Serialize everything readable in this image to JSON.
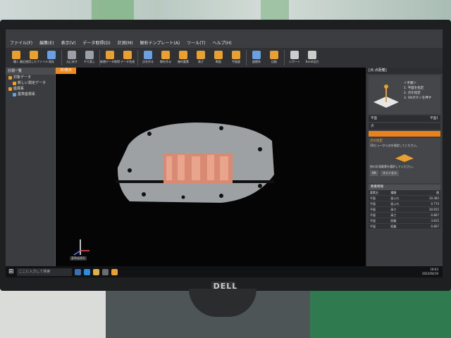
{
  "app": {
    "title": "",
    "menu": [
      "ファイル(F)",
      "編集(E)",
      "表示(V)",
      "データ取得(D)",
      "計測(M)",
      "解析テンプレート(A)",
      "ツール(T)",
      "ヘルプ(H)"
    ]
  },
  "toolbar": {
    "items": [
      {
        "label": "開く",
        "icon": "open-icon",
        "color": "#e8a030"
      },
      {
        "label": "最近使用したファイル",
        "icon": "recent-files-icon",
        "color": "#e8a030"
      },
      {
        "label": "保存",
        "icon": "save-icon",
        "color": "#6aa0e0"
      },
      {
        "label": "元に戻す",
        "icon": "undo-icon",
        "color": "#9aa0a6"
      },
      {
        "label": "やり直し",
        "icon": "redo-icon",
        "color": "#9aa0a6"
      },
      {
        "label": "新規データ取得",
        "icon": "new-data-icon",
        "color": "#e8a030"
      },
      {
        "label": "データ合成",
        "icon": "data-merge-icon",
        "color": "#e8a030"
      },
      {
        "label": "点を作る",
        "icon": "point-icon",
        "color": "#6aa0e0"
      },
      {
        "label": "線を作る",
        "icon": "line-icon",
        "color": "#e8a030"
      },
      {
        "label": "幾何要素",
        "icon": "geometry-icon",
        "color": "#e8a030"
      },
      {
        "label": "高さ",
        "icon": "height-icon",
        "color": "#e8a030"
      },
      {
        "label": "断面",
        "icon": "section-icon",
        "color": "#e8a030"
      },
      {
        "label": "平面度",
        "icon": "flatness-icon",
        "color": "#e8a030"
      },
      {
        "label": "座標系",
        "icon": "coordinate-icon",
        "color": "#6aa0e0"
      },
      {
        "label": "比較",
        "icon": "compare-icon",
        "color": "#e8a030"
      },
      {
        "label": "レポート",
        "icon": "report-icon",
        "color": "#cccccc"
      },
      {
        "label": "Excel出力",
        "icon": "excel-icon",
        "color": "#cccccc"
      }
    ]
  },
  "left_panel": {
    "title": "計測一覧",
    "items": [
      {
        "label": "対象データ",
        "icon": "folder-icon"
      },
      {
        "label": "新しい測定データ",
        "icon": "data-icon"
      },
      {
        "label": "座標系",
        "icon": "folder-icon"
      },
      {
        "label": "基準座標系",
        "icon": "axis-icon"
      }
    ]
  },
  "viewport": {
    "tab": "3D表示",
    "axis_label": "基準座標系"
  },
  "right_panel": {
    "title": "[点-点距離]",
    "steps": [
      "＜手順＞",
      "1. 平面を指定",
      "2. 点を指定",
      "3. OKボタンを押す"
    ],
    "row_plane": "平面",
    "row_plane_value": "平面1",
    "row_point": "点",
    "button_specify": "点を選択",
    "info_title": "点の指定",
    "info_text": "3Dビューから点を指定してください。",
    "info_text2": "他の計測要素を選択してください。",
    "ok": "OK",
    "cancel": "キャンセル",
    "table_title": "要素情報",
    "table_headers": [
      "要素名",
      "種類",
      "値"
    ],
    "table_rows": [
      [
        "平面",
        "面ふれ",
        "10.383"
      ],
      [
        "平面",
        "面ふれ",
        "0.774"
      ],
      [
        "平面",
        "高さ",
        "30.815"
      ],
      [
        "平面",
        "高さ",
        "0.807"
      ],
      [
        "平面",
        "距離",
        "3.815"
      ],
      [
        "平面",
        "距離",
        "0.807"
      ]
    ]
  },
  "taskbar": {
    "search_placeholder": "ここに入力して検索",
    "time": "18:03",
    "date": "2022/04/19"
  },
  "monitor": {
    "brand": "DELL"
  }
}
